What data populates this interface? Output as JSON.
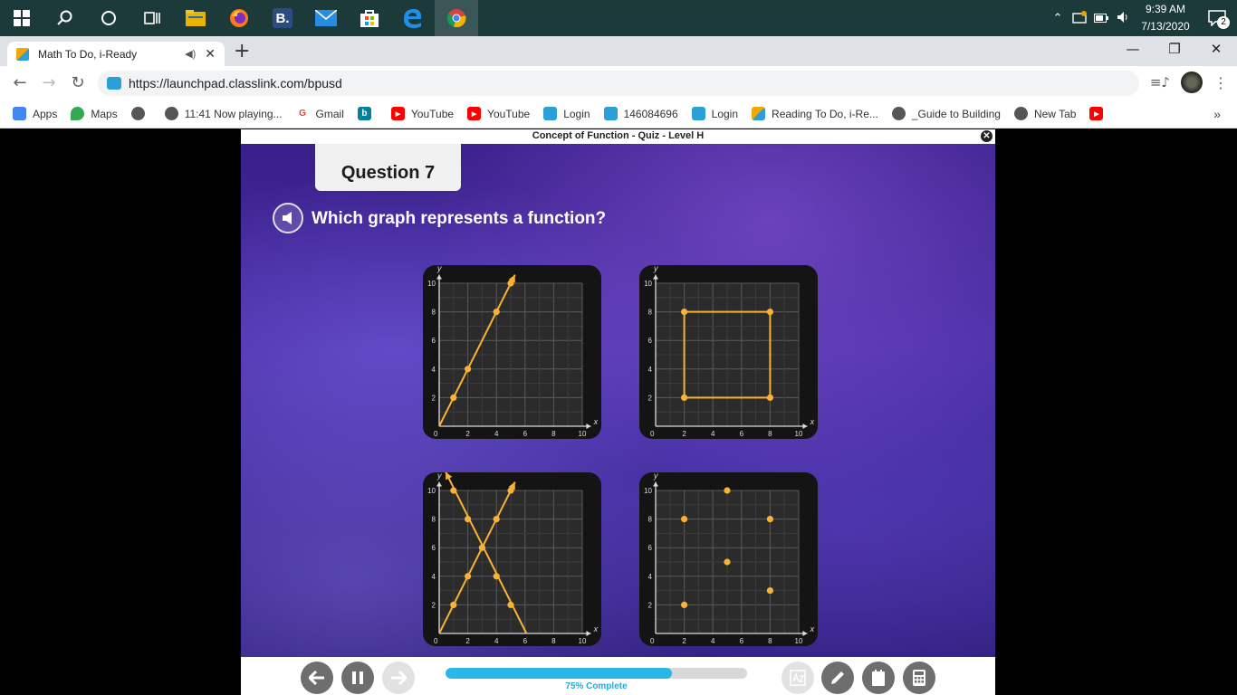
{
  "taskbar": {
    "icons": [
      "windows-start-icon",
      "search-icon",
      "cortana-icon",
      "task-view-icon",
      "file-explorer-icon",
      "firefox-icon",
      "b-app-icon",
      "mail-icon",
      "store-icon",
      "edge-icon",
      "chrome-icon"
    ],
    "b_app_letter": "B.",
    "time": "9:39 AM",
    "date": "7/13/2020",
    "notification_count": "2"
  },
  "browser": {
    "tab_title": "Math To Do, i-Ready",
    "url": "https://launchpad.classlink.com/bpusd"
  },
  "bookmarks": [
    {
      "label": "Apps",
      "icon": "apps-grid-icon",
      "color": "#4285f4"
    },
    {
      "label": "Maps",
      "icon": "maps-icon",
      "color": "#34a853"
    },
    {
      "label": "",
      "icon": "globe-icon",
      "color": "#555555"
    },
    {
      "label": "11:41 Now playing...",
      "icon": "globe-icon",
      "color": "#555555"
    },
    {
      "label": "Gmail",
      "icon": "google-icon",
      "color": "#ea4335"
    },
    {
      "label": "",
      "icon": "bing-icon",
      "color": "#00809d"
    },
    {
      "label": "YouTube",
      "icon": "youtube-icon",
      "color": "#ff0000"
    },
    {
      "label": "YouTube",
      "icon": "youtube-icon",
      "color": "#ff0000"
    },
    {
      "label": "Login",
      "icon": "classlink-icon",
      "color": "#2a9fd8"
    },
    {
      "label": "146084696",
      "icon": "classlink-icon",
      "color": "#2a9fd8"
    },
    {
      "label": "Login",
      "icon": "classlink-icon",
      "color": "#2a9fd8"
    },
    {
      "label": "Reading To Do, i-Re...",
      "icon": "iready-icon",
      "color": "#f7a600"
    },
    {
      "label": "_Guide to Building",
      "icon": "globe-icon",
      "color": "#555555"
    },
    {
      "label": "New Tab",
      "icon": "globe-icon",
      "color": "#555555"
    },
    {
      "label": "",
      "icon": "youtube-icon",
      "color": "#ff0000"
    }
  ],
  "lesson": {
    "frame_title": "Concept of Function - Quiz - Level H",
    "question_label": "Question 7",
    "prompt": "Which graph represents a function?",
    "progress_percent": 75,
    "progress_text": "75% Complete"
  },
  "axis": {
    "y_label": "y",
    "x_label": "x",
    "x_ticks": [
      "2",
      "4",
      "6",
      "8",
      "10"
    ],
    "y_ticks": [
      "2",
      "4",
      "6",
      "8",
      "10"
    ],
    "origin": "0"
  },
  "graphs": [
    {
      "name": "graph-a-line",
      "lines": [
        {
          "from": [
            0,
            0
          ],
          "to": [
            5.3,
            10.6
          ],
          "arrow": true
        }
      ],
      "points": [
        [
          1,
          2
        ],
        [
          2,
          4
        ],
        [
          4,
          8
        ],
        [
          5,
          10
        ]
      ],
      "rect": null
    },
    {
      "name": "graph-b-square",
      "lines": [],
      "points": [
        [
          2,
          2
        ],
        [
          2,
          8
        ],
        [
          8,
          8
        ],
        [
          8,
          2
        ]
      ],
      "rect": [
        [
          2,
          2
        ],
        [
          8,
          8
        ]
      ]
    },
    {
      "name": "graph-c-x-lines",
      "lines": [
        {
          "from": [
            0,
            0
          ],
          "to": [
            5.3,
            10.6
          ],
          "arrow": true
        },
        {
          "from": [
            6.1,
            0
          ],
          "to": [
            0.45,
            11.3
          ],
          "arrow": true
        }
      ],
      "points": [
        [
          1,
          2
        ],
        [
          2,
          4
        ],
        [
          3,
          6
        ],
        [
          4,
          8
        ],
        [
          5,
          10
        ],
        [
          1,
          10
        ],
        [
          2,
          8
        ],
        [
          4,
          4
        ],
        [
          5,
          2
        ]
      ],
      "rect": null
    },
    {
      "name": "graph-d-points",
      "lines": [],
      "points": [
        [
          2,
          2
        ],
        [
          2,
          8
        ],
        [
          5,
          10
        ],
        [
          5,
          5
        ],
        [
          8,
          8
        ],
        [
          8,
          3
        ]
      ],
      "rect": null
    }
  ],
  "colors": {
    "graph_yellow": "#f9b233",
    "progress_blue": "#29b6e8"
  }
}
